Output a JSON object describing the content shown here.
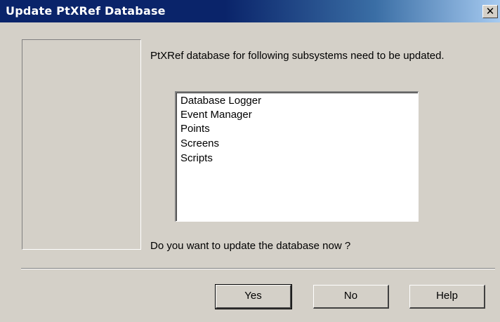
{
  "window": {
    "title": "Update PtXRef Database",
    "close_glyph": "✕"
  },
  "message": "PtXRef database for following subsystems need to be updated.",
  "subsystems": [
    "Database Logger",
    "Event Manager",
    "Points",
    "Screens",
    "Scripts"
  ],
  "question": "Do you want to update the database now ?",
  "buttons": {
    "yes": "Yes",
    "no": "No",
    "help": "Help"
  },
  "colors": {
    "title_bar": "#0a246a",
    "dialog_bg": "#d4d0c8",
    "list_bg": "#ffffff"
  }
}
